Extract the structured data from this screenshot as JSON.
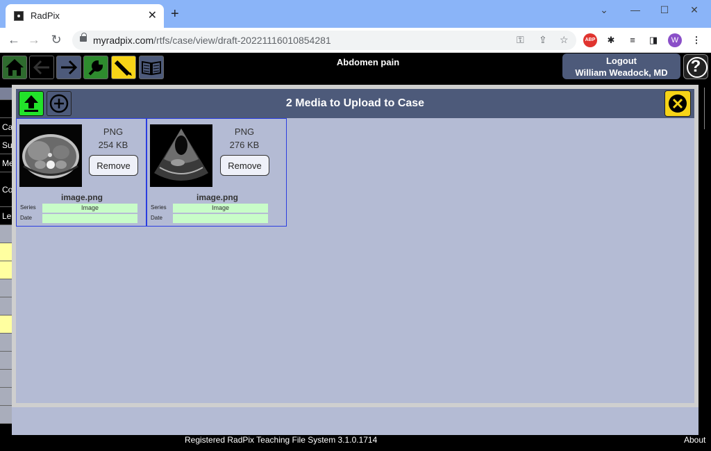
{
  "browser": {
    "tab_title": "RadPix",
    "url_host": "myradpix.com",
    "url_path": "/rtfs/case/view/draft-20221116010854281",
    "profile_initial": "W",
    "abp_label": "ABP"
  },
  "app": {
    "case_title": "Abdomen pain",
    "logout_label": "Logout",
    "user_name": "William Weadock, MD",
    "help_label": "?",
    "footer_text": "Registered RadPix Teaching File System 3.1.0.1714",
    "about_label": "About",
    "left_strip": [
      "Ca",
      "Su",
      "Me",
      "Co",
      "Le"
    ]
  },
  "modal": {
    "title": "2 Media to Upload to Case",
    "series_label": "Series",
    "date_label": "Date",
    "remove_label": "Remove",
    "items": [
      {
        "type": "PNG",
        "size": "254 KB",
        "filename": "image.png",
        "series": "Image",
        "date": ""
      },
      {
        "type": "PNG",
        "size": "276 KB",
        "filename": "image.png",
        "series": "Image",
        "date": ""
      }
    ]
  },
  "colors": {
    "header_blue": "#4d5a7a",
    "panel_bg": "#b4bbd4",
    "upload_green": "#22e22a",
    "close_yellow": "#f7d417",
    "field_green": "#c8fcc8"
  }
}
